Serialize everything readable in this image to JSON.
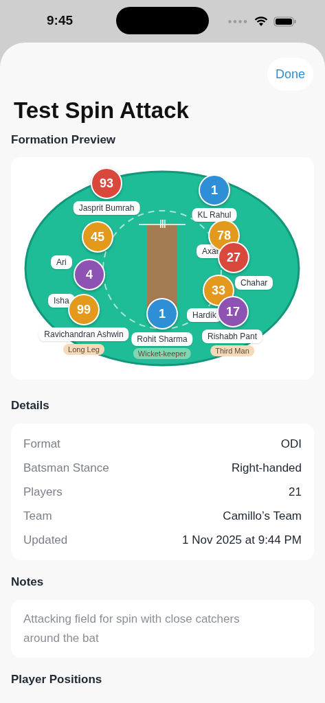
{
  "status_bar": {
    "time": "9:45"
  },
  "sheet": {
    "done_button": "Done",
    "title": "Test Spin Attack"
  },
  "formation_preview": {
    "heading": "Formation Preview",
    "players": [
      {
        "number": "93",
        "color": "#d9483b",
        "label": "Jasprit Bumrah"
      },
      {
        "number": "1",
        "color": "#2f8fd6",
        "label": "KL Rahul"
      },
      {
        "number": "78",
        "color": "#e39a1c",
        "label": "Axar"
      },
      {
        "number": "27",
        "color": "#d9483b",
        "label": "Chahar"
      },
      {
        "number": "45",
        "color": "#e39a1c",
        "label": "Ari"
      },
      {
        "number": "4",
        "color": "#8e52b3",
        "label": "Isha"
      },
      {
        "number": "99",
        "color": "#e39a1c",
        "label": "Ravichandran Ashwin"
      },
      {
        "number": "1",
        "color": "#2f8fd6",
        "label": "Rohit Sharma"
      },
      {
        "number": "33",
        "color": "#e39a1c",
        "label": "Hardik"
      },
      {
        "number": "17",
        "color": "#8e52b3",
        "label": "Rishabh Pant"
      }
    ],
    "position_tags": [
      {
        "text": "Long Leg",
        "color": "#f5d9b8"
      },
      {
        "text": "Wicket-keeper",
        "color": "#7fd6b0"
      },
      {
        "text": "Third Man",
        "color": "#f5d9b8"
      }
    ]
  },
  "details": {
    "heading": "Details",
    "rows": [
      {
        "label": "Format",
        "value": "ODI"
      },
      {
        "label": "Batsman Stance",
        "value": "Right-handed"
      },
      {
        "label": "Players",
        "value": "21"
      },
      {
        "label": "Team",
        "value": "Camillo’s Team"
      },
      {
        "label": "Updated",
        "value": "1 Nov 2025 at 9:44 PM"
      }
    ]
  },
  "notes": {
    "heading": "Notes",
    "text": "Attacking field for spin with close catchers around the bat"
  },
  "player_positions": {
    "heading": "Player Positions"
  }
}
